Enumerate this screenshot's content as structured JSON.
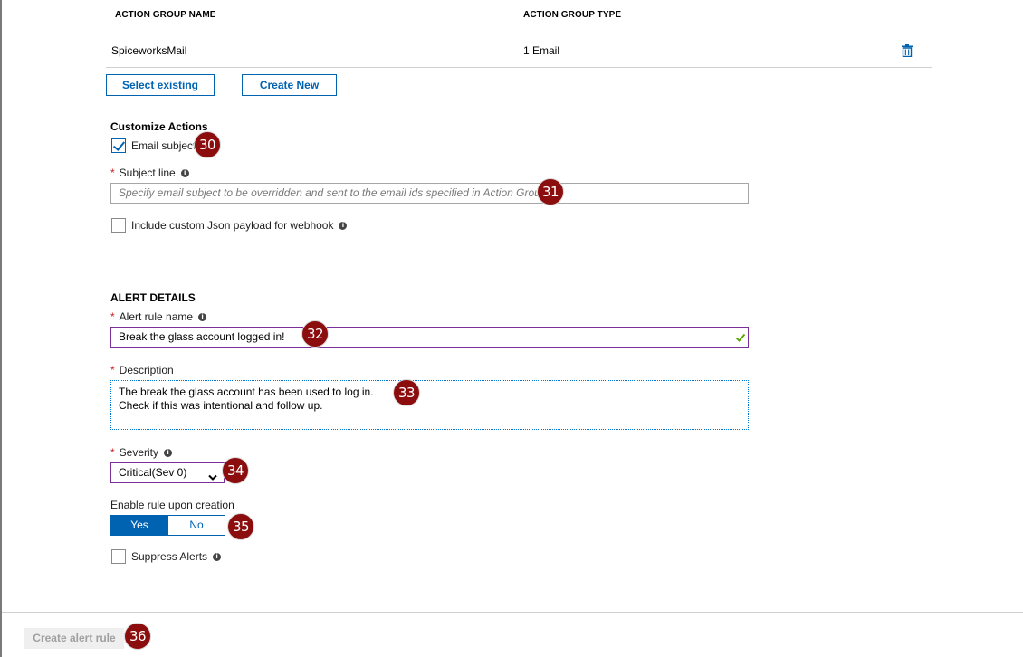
{
  "table": {
    "headers": [
      "ACTION GROUP NAME",
      "ACTION GROUP TYPE"
    ],
    "rows": [
      {
        "name": "SpiceworksMail",
        "type": "1 Email"
      }
    ]
  },
  "buttons": {
    "select_existing": "Select existing",
    "create_new": "Create New",
    "create_alert_rule": "Create alert rule"
  },
  "customize_actions": {
    "title": "Customize Actions",
    "email_subject_label": "Email subject",
    "email_subject_checked": true,
    "subject_line_label": "Subject line",
    "subject_line_placeholder": "Specify email subject to be overridden and sent to the email ids specified in Action Group",
    "json_payload_label": "Include custom Json payload for webhook",
    "json_payload_checked": false
  },
  "alert_details": {
    "title": "ALERT DETAILS",
    "rule_name_label": "Alert rule name",
    "rule_name_value": "Break the glass account logged in!",
    "description_label": "Description",
    "description_line1": "The break the glass account has been used to log in.",
    "description_line2": "Check if this was intentional and follow up.",
    "severity_label": "Severity",
    "severity_value": "Critical(Sev 0)",
    "enable_label": "Enable rule upon creation",
    "enable_yes": "Yes",
    "enable_no": "No",
    "enable_selected": "Yes",
    "suppress_label": "Suppress Alerts",
    "suppress_checked": false
  },
  "required_marker": "*",
  "info_glyph": "i",
  "callouts": [
    "30",
    "31",
    "32",
    "33",
    "34",
    "35",
    "36"
  ],
  "colors": {
    "accent": "#0063b1",
    "badge": "#8b0d0d",
    "required": "#cc2222",
    "valid_check": "#57a300",
    "focus_border": "#7a2f9a"
  }
}
